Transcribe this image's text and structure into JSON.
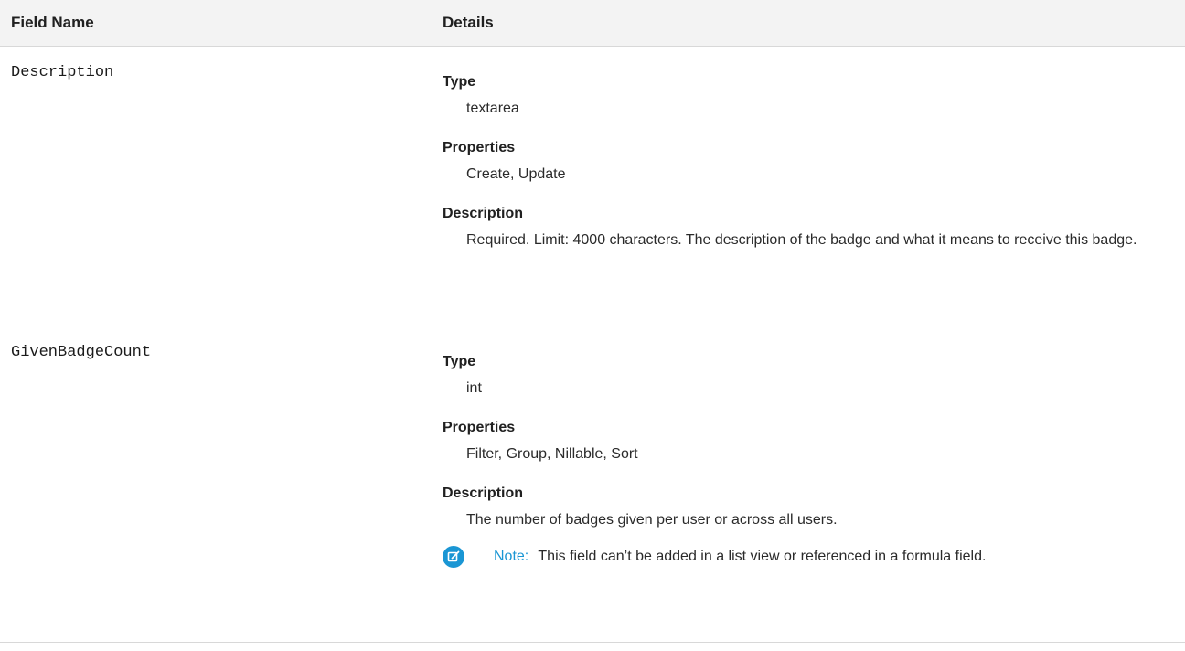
{
  "header": {
    "field_name": "Field Name",
    "details": "Details"
  },
  "rows": [
    {
      "field": "Description",
      "type_label": "Type",
      "type_value": "textarea",
      "properties_label": "Properties",
      "properties_value": "Create, Update",
      "description_label": "Description",
      "description_value": "Required. Limit: 4000 characters. The description of the badge and what it means to receive this badge."
    },
    {
      "field": "GivenBadgeCount",
      "type_label": "Type",
      "type_value": "int",
      "properties_label": "Properties",
      "properties_value": "Filter, Group, Nillable, Sort",
      "description_label": "Description",
      "description_value": "The number of badges given per user or across all users.",
      "note_label": "Note:",
      "note_text": "This field can’t be added in a list view or referenced in a formula field."
    }
  ],
  "colors": {
    "header_bg": "#f3f3f3",
    "divider": "#d8d8d8",
    "note_accent": "#1a96d4"
  },
  "icons": {
    "note": "note-edit-icon"
  }
}
